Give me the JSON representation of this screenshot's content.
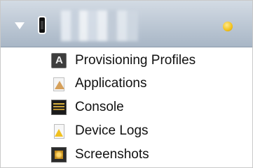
{
  "device": {
    "name": "iPhone",
    "status_color": "#f2c21c",
    "disclosure_icon": "disclosure-triangle-expanded",
    "device_icon": "iphone-icon"
  },
  "items": [
    {
      "label": "Provisioning Profiles",
      "icon": "provisioning-icon"
    },
    {
      "label": "Applications",
      "icon": "applications-icon"
    },
    {
      "label": "Console",
      "icon": "console-icon"
    },
    {
      "label": "Device Logs",
      "icon": "device-logs-icon"
    },
    {
      "label": "Screenshots",
      "icon": "screenshots-icon"
    }
  ]
}
